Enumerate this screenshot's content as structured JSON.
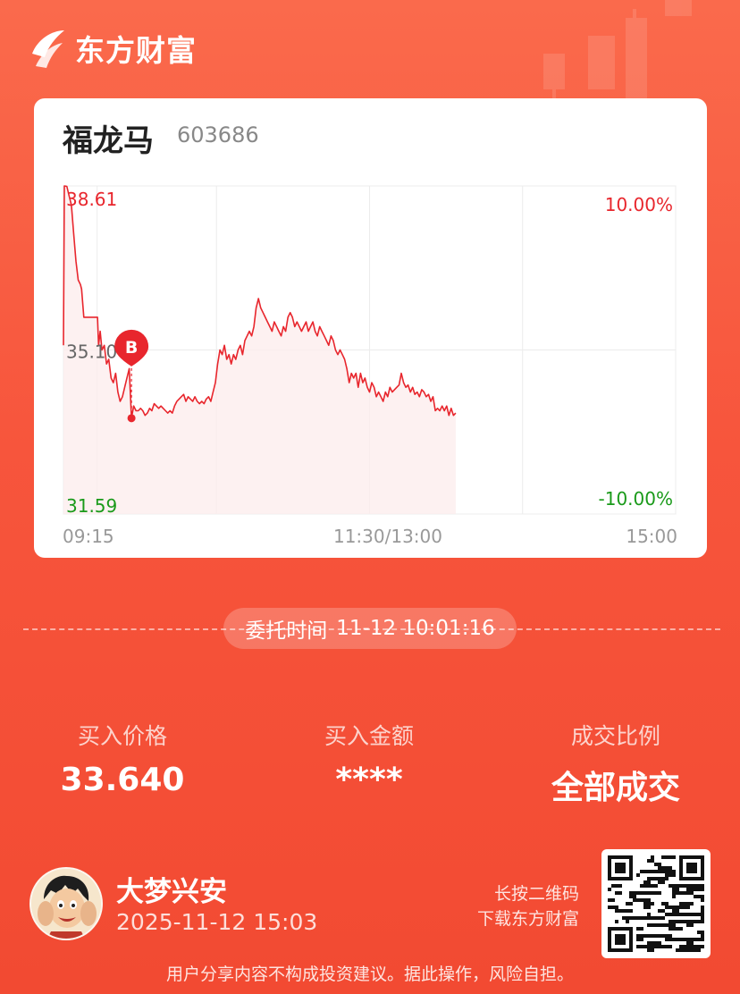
{
  "brand": {
    "name": "东方财富"
  },
  "stock": {
    "name": "福龙马",
    "code": "603686"
  },
  "chart_data": {
    "type": "line",
    "y_labels": {
      "high": "38.61",
      "mid": "35.10",
      "low": "31.59"
    },
    "pct_labels": {
      "high": "10.00%",
      "low": "-10.00%"
    },
    "x_labels": {
      "start": "09:15",
      "mid": "11:30/13:00",
      "end": "15:00"
    },
    "ylim": [
      31.59,
      38.61
    ],
    "x_range": [
      0,
      270
    ],
    "marker": {
      "label": "B",
      "x": 30,
      "y": 33.64
    },
    "colors": {
      "up": "#e8262d",
      "down": "#1a9a1a",
      "line": "#e8262d"
    },
    "series": [
      {
        "values": [
          [
            0,
            35.2
          ],
          [
            0.4,
            38.61
          ],
          [
            1.5,
            38.6
          ],
          [
            2.5,
            38.4
          ],
          [
            3.5,
            38.2
          ],
          [
            4.5,
            37.6
          ],
          [
            5.5,
            37.0
          ],
          [
            6.5,
            36.6
          ],
          [
            7.5,
            36.5
          ],
          [
            8,
            36.4
          ],
          [
            9,
            35.8
          ],
          [
            9.5,
            35.8
          ],
          [
            10,
            35.8
          ],
          [
            11,
            35.8
          ],
          [
            12,
            35.8
          ],
          [
            13,
            35.8
          ],
          [
            14,
            35.8
          ],
          [
            15,
            35.8
          ],
          [
            15.5,
            35.2
          ],
          [
            16.2,
            35.5
          ],
          [
            17,
            35.1
          ],
          [
            18,
            35.2
          ],
          [
            19,
            34.8
          ],
          [
            20,
            34.9
          ],
          [
            21,
            34.5
          ],
          [
            22,
            34.4
          ],
          [
            23,
            34.6
          ],
          [
            24,
            34.2
          ],
          [
            25,
            34.0
          ],
          [
            26,
            34.1
          ],
          [
            27,
            34.3
          ],
          [
            28,
            34.5
          ],
          [
            29,
            34.7
          ],
          [
            30,
            33.64
          ],
          [
            31,
            33.9
          ],
          [
            32,
            33.8
          ],
          [
            33,
            33.8
          ],
          [
            34,
            33.85
          ],
          [
            35,
            33.8
          ],
          [
            36,
            33.7
          ],
          [
            37,
            33.75
          ],
          [
            38,
            33.85
          ],
          [
            39,
            33.8
          ],
          [
            40,
            33.95
          ],
          [
            41,
            33.9
          ],
          [
            42,
            33.85
          ],
          [
            43,
            33.9
          ],
          [
            44,
            33.85
          ],
          [
            45,
            33.8
          ],
          [
            46,
            33.75
          ],
          [
            47,
            33.8
          ],
          [
            48,
            33.75
          ],
          [
            49,
            33.9
          ],
          [
            50,
            34.0
          ],
          [
            51,
            34.05
          ],
          [
            52,
            34.1
          ],
          [
            53,
            34.15
          ],
          [
            54,
            34.0
          ],
          [
            55,
            34.1
          ],
          [
            56,
            34.05
          ],
          [
            57,
            34.0
          ],
          [
            58,
            34.1
          ],
          [
            59,
            34.0
          ],
          [
            60,
            33.95
          ],
          [
            61,
            34.0
          ],
          [
            62,
            33.95
          ],
          [
            63,
            34.05
          ],
          [
            64,
            34.1
          ],
          [
            65,
            34.0
          ],
          [
            66,
            34.2
          ],
          [
            67,
            34.4
          ],
          [
            68,
            34.8
          ],
          [
            69,
            35.1
          ],
          [
            70,
            35.0
          ],
          [
            71,
            35.2
          ],
          [
            72,
            34.9
          ],
          [
            73,
            35.0
          ],
          [
            74,
            34.8
          ],
          [
            75,
            35.0
          ],
          [
            76,
            34.9
          ],
          [
            77,
            35.1
          ],
          [
            78,
            35.2
          ],
          [
            79,
            35.0
          ],
          [
            80,
            35.3
          ],
          [
            81,
            35.4
          ],
          [
            82,
            35.5
          ],
          [
            83,
            35.4
          ],
          [
            84,
            35.6
          ],
          [
            85,
            36.0
          ],
          [
            86,
            36.2
          ],
          [
            87,
            36.0
          ],
          [
            88,
            35.9
          ],
          [
            89,
            35.8
          ],
          [
            90,
            35.7
          ],
          [
            91,
            35.6
          ],
          [
            92,
            35.5
          ],
          [
            93,
            35.7
          ],
          [
            94,
            35.6
          ],
          [
            95,
            35.5
          ],
          [
            96,
            35.4
          ],
          [
            97,
            35.6
          ],
          [
            98,
            35.5
          ],
          [
            99,
            35.8
          ],
          [
            100,
            35.9
          ],
          [
            101,
            35.8
          ],
          [
            102,
            35.6
          ],
          [
            103,
            35.7
          ],
          [
            104,
            35.6
          ],
          [
            105,
            35.5
          ],
          [
            106,
            35.6
          ],
          [
            107,
            35.7
          ],
          [
            108,
            35.5
          ],
          [
            109,
            35.6
          ],
          [
            110,
            35.7
          ],
          [
            111,
            35.5
          ],
          [
            112,
            35.4
          ],
          [
            113,
            35.6
          ],
          [
            114,
            35.5
          ],
          [
            115,
            35.4
          ],
          [
            116,
            35.3
          ],
          [
            117,
            35.2
          ],
          [
            118,
            35.4
          ],
          [
            119,
            35.3
          ],
          [
            120,
            35.1
          ],
          [
            121,
            35.0
          ],
          [
            122,
            35.1
          ],
          [
            123,
            35.0
          ],
          [
            124,
            34.9
          ],
          [
            125,
            34.7
          ],
          [
            126,
            34.4
          ],
          [
            127,
            34.6
          ],
          [
            128,
            34.5
          ],
          [
            129,
            34.6
          ],
          [
            130,
            34.3
          ],
          [
            131,
            34.6
          ],
          [
            132,
            34.4
          ],
          [
            133,
            34.5
          ],
          [
            134,
            34.3
          ],
          [
            135,
            34.2
          ],
          [
            136,
            34.4
          ],
          [
            137,
            34.3
          ],
          [
            138,
            34.1
          ],
          [
            139,
            34.2
          ],
          [
            140,
            34.1
          ],
          [
            141,
            34.0
          ],
          [
            142,
            34.2
          ],
          [
            143,
            34.1
          ],
          [
            144,
            34.3
          ],
          [
            145,
            34.2
          ],
          [
            146,
            34.25
          ],
          [
            147,
            34.3
          ],
          [
            148,
            34.35
          ],
          [
            149,
            34.6
          ],
          [
            150,
            34.4
          ],
          [
            151,
            34.3
          ],
          [
            152,
            34.35
          ],
          [
            153,
            34.2
          ],
          [
            154,
            34.3
          ],
          [
            155,
            34.15
          ],
          [
            156,
            34.2
          ],
          [
            157,
            34.1
          ],
          [
            158,
            34.25
          ],
          [
            159,
            34.2
          ],
          [
            160,
            34.1
          ],
          [
            161,
            34.15
          ],
          [
            162,
            34.0
          ],
          [
            163,
            34.1
          ],
          [
            164,
            33.8
          ],
          [
            165,
            33.85
          ],
          [
            166,
            33.8
          ],
          [
            167,
            33.9
          ],
          [
            168,
            33.8
          ],
          [
            169,
            33.9
          ],
          [
            170,
            33.7
          ],
          [
            171,
            33.85
          ],
          [
            172,
            33.7
          ],
          [
            173,
            33.75
          ]
        ]
      }
    ]
  },
  "order_time": {
    "label": "委托时间",
    "value": "11-12 10:01:16"
  },
  "stats": [
    {
      "label": "买入价格",
      "value": "33.640"
    },
    {
      "label": "买入金额",
      "value": "****"
    },
    {
      "label": "成交比例",
      "value": "全部成交"
    }
  ],
  "user": {
    "name": "大梦兴安",
    "datetime": "2025-11-12 15:03"
  },
  "qr_hint": {
    "line1": "长按二维码",
    "line2": "下载东方财富"
  },
  "disclaimer": "用户分享内容不构成投资建议。据此操作，风险自担。"
}
